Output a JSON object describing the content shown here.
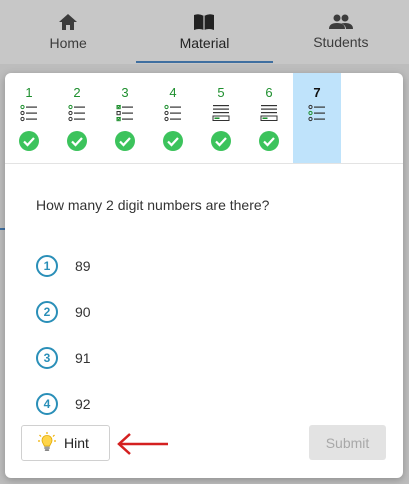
{
  "nav": {
    "items": [
      {
        "label": "Home",
        "icon": "home-icon"
      },
      {
        "label": "Material",
        "icon": "book-icon"
      },
      {
        "label": "Students",
        "icon": "people-icon"
      }
    ],
    "active": "Material"
  },
  "steps": [
    {
      "num": "1",
      "type": "list",
      "completed": true
    },
    {
      "num": "2",
      "type": "list",
      "completed": true
    },
    {
      "num": "3",
      "type": "checklist",
      "completed": true
    },
    {
      "num": "4",
      "type": "list",
      "completed": true
    },
    {
      "num": "5",
      "type": "text-input",
      "completed": true
    },
    {
      "num": "6",
      "type": "text-input",
      "completed": true
    },
    {
      "num": "7",
      "type": "list",
      "completed": false,
      "current": true
    }
  ],
  "question": {
    "text": "How many 2 digit numbers are there?"
  },
  "answers": [
    {
      "index": "1",
      "text": "89"
    },
    {
      "index": "2",
      "text": "90"
    },
    {
      "index": "3",
      "text": "91"
    },
    {
      "index": "4",
      "text": "92"
    }
  ],
  "buttons": {
    "hint_label": "Hint",
    "submit_label": "Submit"
  },
  "colors": {
    "accent": "#2a8fb8",
    "check": "#3cc35c",
    "current_step": "#bfe3fb",
    "arrow": "#d42020"
  }
}
